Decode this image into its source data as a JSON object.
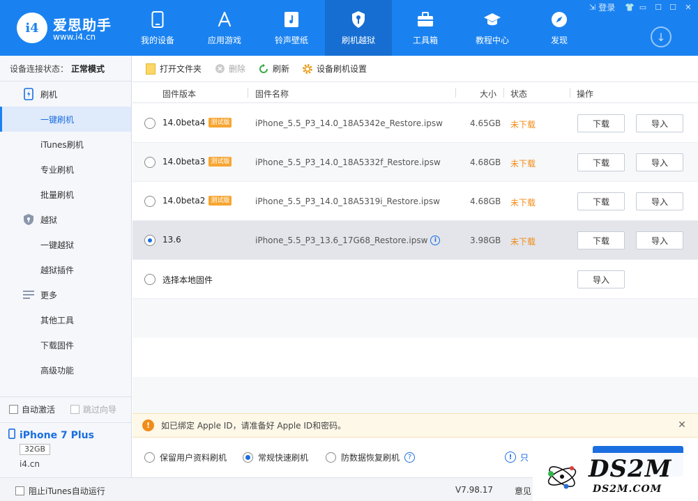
{
  "app": {
    "title": "爱思助手",
    "url": "www.i4.cn",
    "logo_text": "i4"
  },
  "window": {
    "login": "登录",
    "shirt": "👕",
    "minimize": "▭",
    "maximize": "☐",
    "close": "✕"
  },
  "nav": {
    "items": [
      {
        "label": "我的设备",
        "icon": "phone-icon"
      },
      {
        "label": "应用游戏",
        "icon": "appstore-icon"
      },
      {
        "label": "铃声壁纸",
        "icon": "music-icon"
      },
      {
        "label": "刷机越狱",
        "icon": "key-icon"
      },
      {
        "label": "工具箱",
        "icon": "toolbox-icon"
      },
      {
        "label": "教程中心",
        "icon": "graduation-cap-icon"
      },
      {
        "label": "发现",
        "icon": "compass-icon"
      }
    ],
    "active_index": 3
  },
  "sidebar": {
    "conn_label": "设备连接状态：",
    "conn_value": "正常模式",
    "items": [
      {
        "label": "刷机",
        "type": "group"
      },
      {
        "label": "一键刷机",
        "type": "sub",
        "active": true
      },
      {
        "label": "iTunes刷机",
        "type": "sub"
      },
      {
        "label": "专业刷机",
        "type": "sub"
      },
      {
        "label": "批量刷机",
        "type": "sub"
      },
      {
        "label": "越狱",
        "type": "group"
      },
      {
        "label": "一键越狱",
        "type": "sub"
      },
      {
        "label": "越狱插件",
        "type": "sub"
      },
      {
        "label": "更多",
        "type": "group"
      },
      {
        "label": "其他工具",
        "type": "sub"
      },
      {
        "label": "下载固件",
        "type": "sub"
      },
      {
        "label": "高级功能",
        "type": "sub"
      }
    ],
    "auto_activate": "自动激活",
    "skip_guide": "跳过向导",
    "device_name": "iPhone 7 Plus",
    "device_capacity": "32GB",
    "device_site": "i4.cn"
  },
  "toolbar": {
    "open_folder": "打开文件夹",
    "delete": "删除",
    "refresh": "刷新",
    "settings": "设备刷机设置"
  },
  "table": {
    "headers": {
      "version": "固件版本",
      "name": "固件名称",
      "size": "大小",
      "status": "状态",
      "action": "操作"
    },
    "badge": "测试版",
    "download": "下载",
    "import": "导入",
    "rows": [
      {
        "version": "14.0beta4",
        "beta": true,
        "name": "iPhone_5.5_P3_14.0_18A5342e_Restore.ipsw",
        "size": "4.65GB",
        "status": "未下载"
      },
      {
        "version": "14.0beta3",
        "beta": true,
        "name": "iPhone_5.5_P3_14.0_18A5332f_Restore.ipsw",
        "size": "4.68GB",
        "status": "未下载"
      },
      {
        "version": "14.0beta2",
        "beta": true,
        "name": "iPhone_5.5_P3_14.0_18A5319i_Restore.ipsw",
        "size": "4.68GB",
        "status": "未下载"
      },
      {
        "version": "13.6",
        "beta": false,
        "name": "iPhone_5.5_P3_13.6_17G68_Restore.ipsw",
        "size": "3.98GB",
        "status": "未下载",
        "selected": true
      }
    ],
    "local_label": "选择本地固件"
  },
  "alert": {
    "text": "如已绑定 Apple ID，请准备好 Apple ID和密码。",
    "icon": "!",
    "close": "✕"
  },
  "options": {
    "keep_data": "保留用户资料刷机",
    "fast": "常规快速刷机",
    "recovery": "防数据恢复刷机",
    "help": "?",
    "link": "只",
    "warn": "!"
  },
  "footer": {
    "block_itunes": "阻止iTunes自动运行",
    "version": "V7.98.17",
    "feedback": "意见"
  },
  "watermark": {
    "big": "DS2M",
    "small": "DS2M.COM"
  },
  "colors": {
    "brand": "#1a82f0",
    "nav_active": "#166ed2",
    "status_orange": "#f28b16",
    "badge": "#f7a531"
  }
}
